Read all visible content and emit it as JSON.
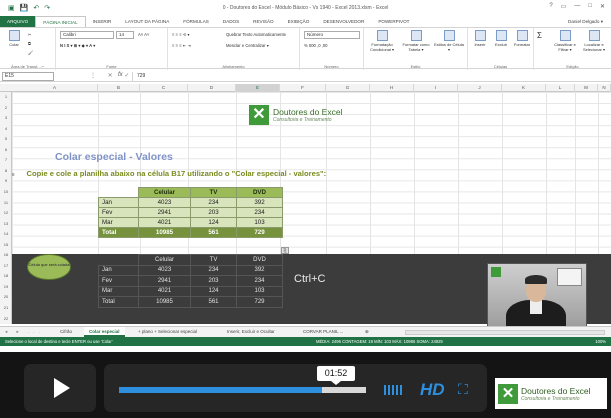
{
  "window": {
    "title": "0 - Doutores do Excel - Módulo Básico - Vs 1940 - Excel 2013.xlsm - Excel",
    "controls": [
      "?",
      "▭",
      "—",
      "□",
      "✕"
    ]
  },
  "ribbon_tabs": {
    "file": "ARQUIVO",
    "tabs": [
      "PÁGINA INICIAL",
      "INSERIR",
      "LAYOUT DA PÁGINA",
      "FÓRMULAS",
      "DADOS",
      "REVISÃO",
      "EXIBIÇÃO",
      "DESENVOLVEDOR",
      "POWERPIVOT"
    ],
    "user": "Daniel Delgado ▾"
  },
  "ribbon": {
    "paste_label": "Colar",
    "font_name": "Calibri",
    "font_size": "14",
    "wrap_text": "Quebrar Texto Automaticamente",
    "merge_center": "Mesclar e Centralizar ▾",
    "number_format": "Número",
    "number_row": "% 000 ,0 ,00",
    "cond_format": "Formatação Condicional ▾",
    "format_table": "Formatar como Tabela ▾",
    "cell_styles": "Estilos de Célula ▾",
    "insert": "Inserir",
    "delete": "Excluir",
    "format": "Formatar",
    "sort_filter": "Classificar e Filtrar ▾",
    "find_select": "Localizar e Selecionar ▾",
    "groups": {
      "clipboard": "Área de Transf... ⌐",
      "font": "Fonte",
      "alignment": "Alinhamento",
      "number": "Número",
      "styles": "Estilo",
      "cells": "Células",
      "editing": "Edição"
    }
  },
  "formula_bar": {
    "name_box": "E15",
    "fx": "fx",
    "value": "729"
  },
  "columns": [
    "A",
    "B",
    "C",
    "D",
    "E",
    "F",
    "G",
    "H",
    "I",
    "J",
    "K",
    "L",
    "M",
    "N"
  ],
  "rows": [
    "1",
    "2",
    "3",
    "4",
    "5",
    "6",
    "7",
    "8",
    "9",
    "10",
    "11",
    "12",
    "13",
    "14",
    "15",
    "16",
    "17",
    "18",
    "19",
    "20",
    "21",
    "22"
  ],
  "logo": {
    "line1": "Doutores do Excel",
    "line2": "Consultoria e Treinamento"
  },
  "sheet": {
    "title": "Colar especial - Valores",
    "instruction_row": "8",
    "instruction": "Copie e cole a planilha abaixo na célula B17 utilizando o \"Colar especial - valores\":"
  },
  "source_table": {
    "headers": [
      "Celular",
      "TV",
      "DVD"
    ],
    "rows": [
      {
        "label": "Jan",
        "values": [
          "4023",
          "234",
          "392"
        ]
      },
      {
        "label": "Fev",
        "values": [
          "2941",
          "203",
          "234"
        ]
      },
      {
        "label": "Mar",
        "values": [
          "4021",
          "124",
          "103"
        ]
      }
    ],
    "total": {
      "label": "Total",
      "values": [
        "10985",
        "561",
        "729"
      ]
    }
  },
  "pasted_table": {
    "headers": [
      "Celular",
      "TV",
      "DVD"
    ],
    "rows": [
      {
        "label": "Jan",
        "values": [
          "4023",
          "234",
          "392"
        ]
      },
      {
        "label": "Fev",
        "values": [
          "2941",
          "203",
          "234"
        ]
      },
      {
        "label": "Mar",
        "values": [
          "4021",
          "124",
          "103"
        ]
      }
    ],
    "total": {
      "label": "Total",
      "values": [
        "10985",
        "561",
        "729"
      ]
    }
  },
  "callout": "Célula que será colada",
  "overlay_text": "Ctrl+C",
  "sheet_tabs": {
    "nav": "◂ ▸ ...",
    "tabs": [
      "Cifrão",
      "Colar especial",
      "+ plano + Selecionar especial",
      "Inserir, Excluir e Ocultar",
      "CORVAR PLANIL ..."
    ],
    "active_index": 1,
    "add": "⊕"
  },
  "status_bar": {
    "message": "Selecione o local de destino e tecle ENTER ou use 'Colar'",
    "stats": "MÉDIA: 2496   CONTAGEM: 19   MÍN: 103   MÁX: 10985   SOMA: 24929",
    "zoom": "100%"
  },
  "player": {
    "time": "01:52",
    "progress": 0.82,
    "hd_label": "HD",
    "fullscreen_icon": "⛶",
    "brand_line1": "Doutores do Excel",
    "brand_line2": "Consultoria e Treinamento"
  }
}
